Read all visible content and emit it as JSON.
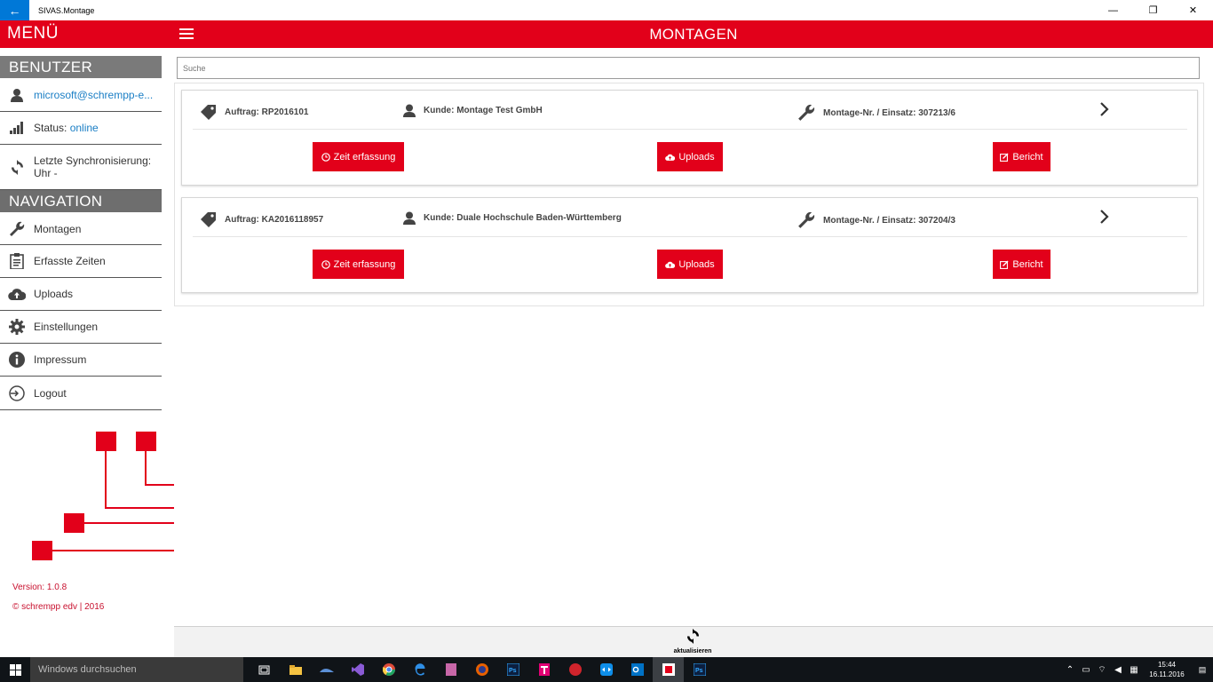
{
  "window": {
    "app_title": "SIVAS.Montage",
    "back_label": "←",
    "minimize_label": "—",
    "restore_label": "❐",
    "close_label": "✕"
  },
  "header": {
    "menu_title": "MENÜ",
    "page_title": "MONTAGEN"
  },
  "sidebar": {
    "user_section": "BENUTZER",
    "user_email": "microsoft@schrempp-e...",
    "status_label": "Status:",
    "status_value": "online",
    "sync_label": "Letzte Synchronisierung:",
    "sync_value": "Uhr -",
    "nav_section": "NAVIGATION",
    "nav_items": [
      {
        "label": "Montagen",
        "icon": "wrench-icon"
      },
      {
        "label": "Erfasste Zeiten",
        "icon": "clipboard-icon"
      },
      {
        "label": "Uploads",
        "icon": "cloud-upload-icon"
      },
      {
        "label": "Einstellungen",
        "icon": "gear-icon"
      },
      {
        "label": "Impressum",
        "icon": "info-icon"
      },
      {
        "label": "Logout",
        "icon": "logout-icon"
      }
    ],
    "version": "Version: 1.0.8",
    "copyright": "© schrempp edv | 2016"
  },
  "search": {
    "placeholder": "Suche"
  },
  "orders": [
    {
      "auftrag": "Auftrag: RP2016101",
      "kunde": "Kunde: Montage Test GmbH",
      "montage_nr": "Montage-Nr. / Einsatz: 307213/6",
      "btn_time": "Zeit erfassung",
      "btn_uploads": "Uploads",
      "btn_report": "Bericht"
    },
    {
      "auftrag": "Auftrag: KA2016118957",
      "kunde": "Kunde: Duale Hochschule Baden-Württemberg",
      "montage_nr": "Montage-Nr. / Einsatz: 307204/3",
      "btn_time": "Zeit erfassung",
      "btn_uploads": "Uploads",
      "btn_report": "Bericht"
    }
  ],
  "commandbar": {
    "refresh_label": "aktualisieren"
  },
  "taskbar": {
    "search_placeholder": "Windows durchsuchen",
    "time": "15:44",
    "date": "16.11.2016"
  },
  "colors": {
    "brand_red": "#e2001a",
    "link_blue": "#1a7ec5",
    "section_gray": "#7a7a7a"
  }
}
